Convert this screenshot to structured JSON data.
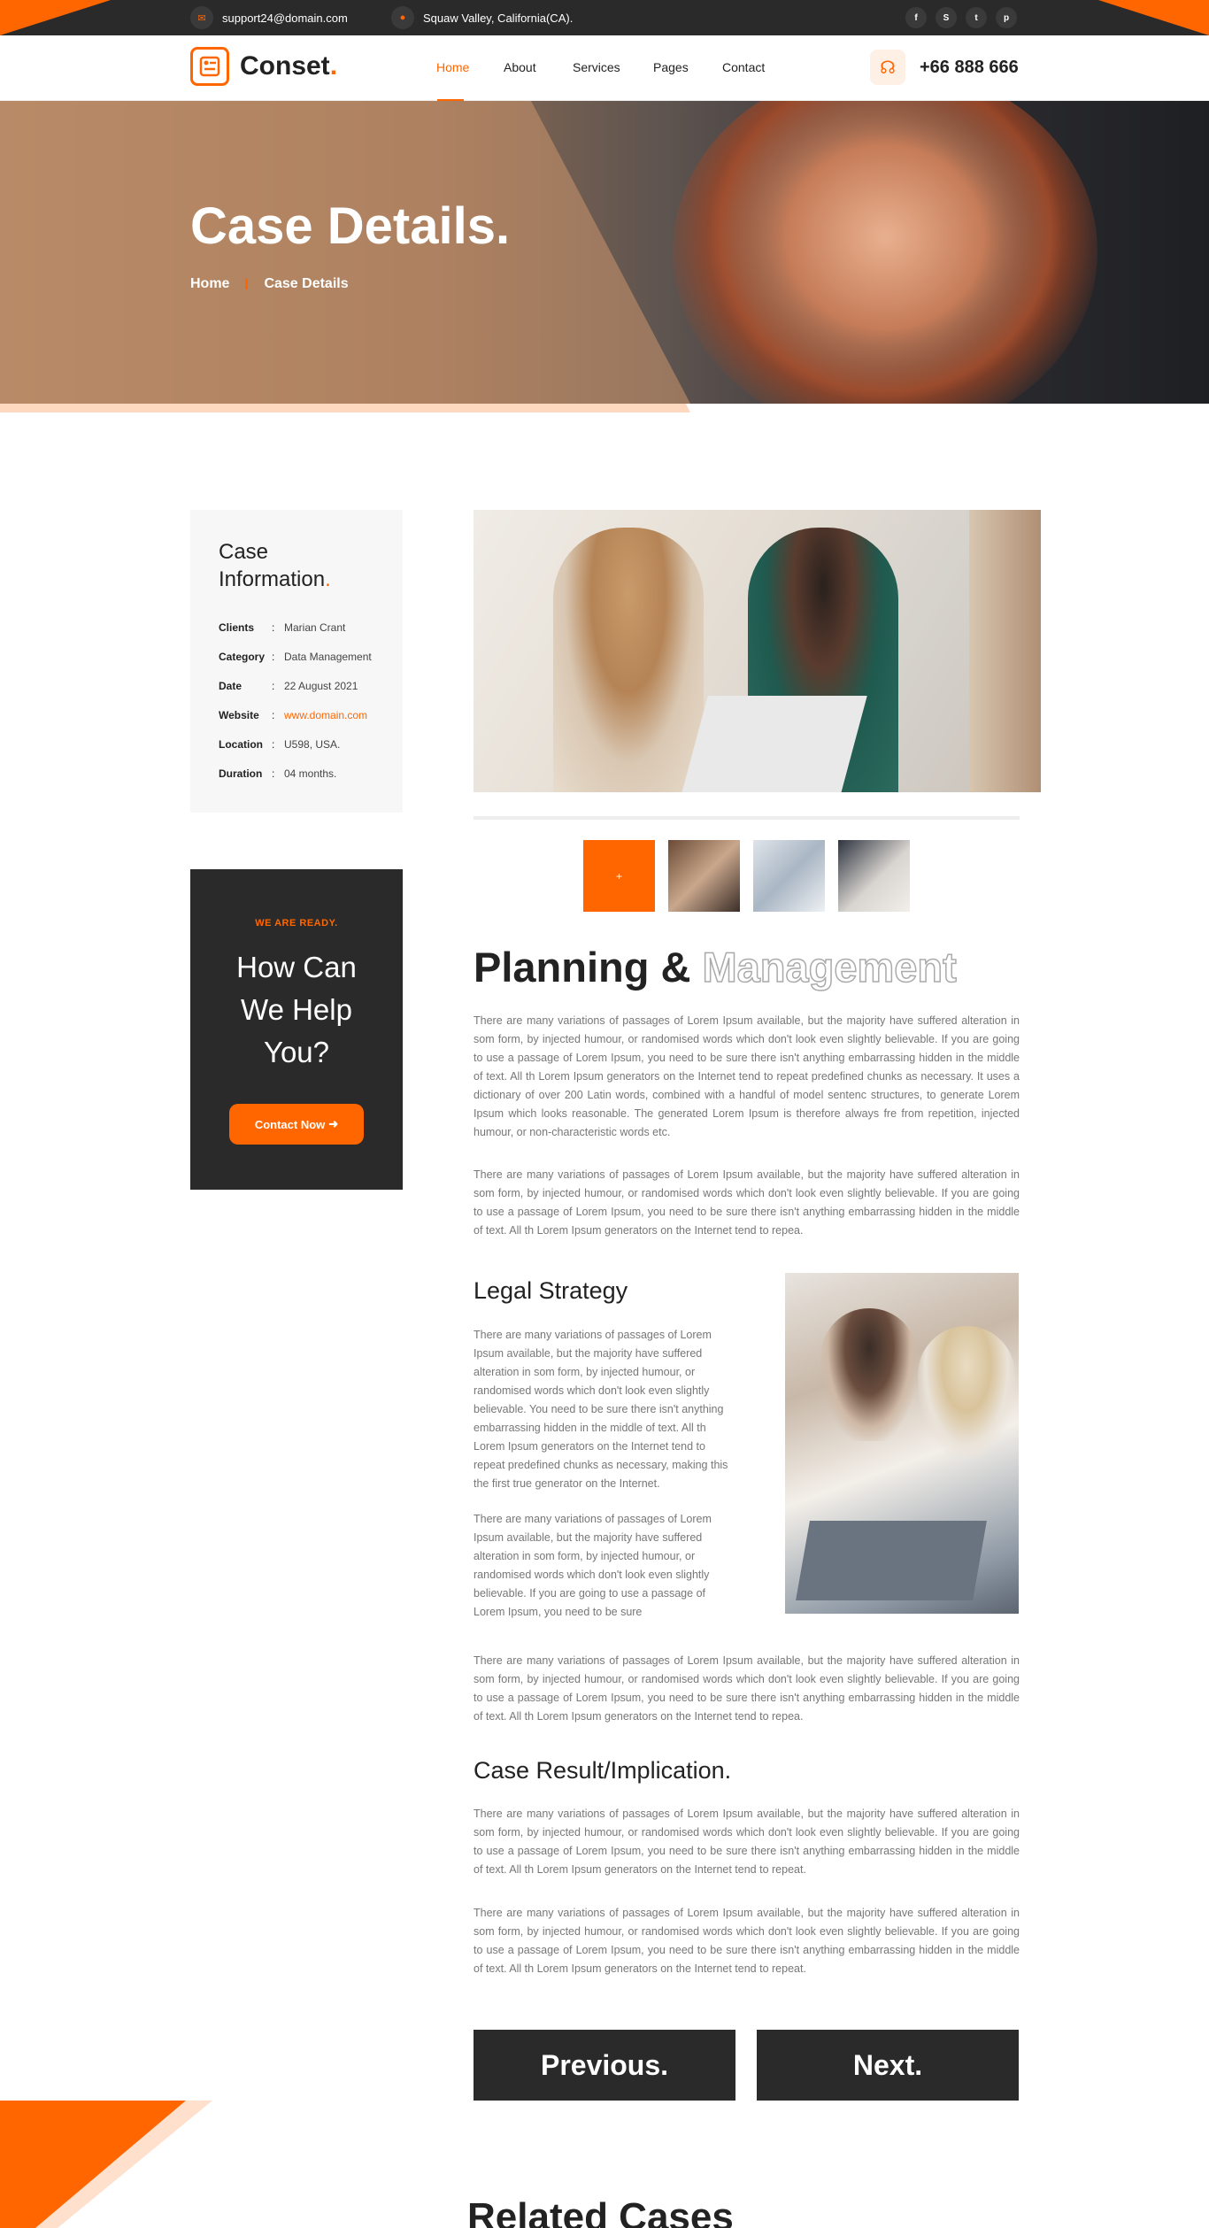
{
  "topbar": {
    "email": "support24@domain.com",
    "address": "Squaw Valley, California(CA).",
    "social_icons": [
      "facebook-icon",
      "skype-icon",
      "twitter-icon",
      "pinterest-icon"
    ],
    "social_glyphs": [
      "f",
      "S",
      "t",
      "p"
    ]
  },
  "header": {
    "logo": "Conset",
    "logo_dot": ".",
    "nav": [
      "Home",
      "About",
      "Services",
      "Pages",
      "Contact"
    ],
    "active_nav": "Home",
    "phone": "+66 888 666"
  },
  "hero": {
    "title": "Case Details.",
    "breadcrumb_home": "Home",
    "breadcrumb_current": "Case Details"
  },
  "case_info": {
    "title": "Case Information",
    "title_dot": ".",
    "rows": [
      {
        "key": "Clients",
        "value": "Marian Crant"
      },
      {
        "key": "Category",
        "value": "Data Management"
      },
      {
        "key": "Date",
        "value": "22 August 2021"
      },
      {
        "key": "Website",
        "value": "www.domain.com"
      },
      {
        "key": "Location",
        "value": "U598, USA."
      },
      {
        "key": "Duration",
        "value": "04 months."
      }
    ]
  },
  "help": {
    "eyebrow": "WE ARE READY.",
    "title_lines": [
      "How Can",
      "We Help",
      "You?"
    ],
    "button": "Contact Now"
  },
  "main": {
    "title_solid": "Planning &",
    "title_outline": "Management",
    "intro_paragraphs": [
      "There are many variations of passages of Lorem Ipsum available, but the majority have suffered alteration in som form, by injected humour, or randomised words which don't look even slightly believable. If you are going to use a passage of Lorem Ipsum, you need to be sure there isn't anything embarrassing hidden in the middle of text. All th Lorem Ipsum generators on the Internet tend to repeat predefined chunks as necessary. It uses a dictionary of over 200 Latin words, combined with a handful of model sentenc structures, to generate Lorem Ipsum which looks reasonable. The generated Lorem Ipsum is therefore always fre from repetition, injected humour, or non-characteristic words etc.",
      "There are many variations of passages of Lorem Ipsum available, but the majority have suffered alteration in som form, by injected humour, or randomised words which don't look even slightly believable. If you are going to use a passage of Lorem Ipsum, you need to be sure there isn't anything embarrassing hidden in the middle of text. All th Lorem Ipsum generators on the Internet tend to repea."
    ],
    "legal_title": "Legal Strategy",
    "legal_paragraphs": [
      "There are many variations of passages of Lorem Ipsum available, but the majority have suffered alteration in som form, by injected humour, or randomised words which don't look even slightly believable. You need to be sure there isn't anything embarrassing hidden in the middle of text. All th Lorem Ipsum generators on the Internet tend to repeat predefined chunks as necessary, making this the first true generator on the Internet.",
      "There are many variations of passages of Lorem Ipsum available, but the majority have suffered alteration in som form, by injected humour, or randomised words which don't look even slightly believable. If you are going to use a passage of Lorem Ipsum, you need to be sure"
    ],
    "after_legal": "There are many variations of passages of Lorem Ipsum available, but the majority have suffered alteration in som form, by injected humour, or randomised words which don't look even slightly believable. If you are going to use a passage of Lorem Ipsum, you need to be sure there isn't anything embarrassing hidden in the middle of text. All th Lorem Ipsum generators on the Internet tend to repea.",
    "result_title": "Case Result/Implication.",
    "result_paragraphs": [
      "There are many variations of passages of Lorem Ipsum available, but the majority have suffered alteration in som form, by injected humour, or randomised words which don't look even slightly believable. If you are going to use a passage of Lorem Ipsum, you need to be sure there isn't anything embarrassing hidden in the middle of text. All th Lorem Ipsum generators on the Internet tend to repeat.",
      "There are many variations of passages of Lorem Ipsum available, but the majority have suffered alteration in som form, by injected humour, or randomised words which don't look even slightly believable. If you are going to use a passage of Lorem Ipsum, you need to be sure there isn't anything embarrassing hidden in the middle of text. All th Lorem Ipsum generators on the Internet tend to repeat."
    ],
    "prev_button": "Previous.",
    "next_button": "Next.",
    "thumb_plus": "+"
  },
  "related_title": "Related Cases",
  "colors": {
    "accent": "#ff6600",
    "dark": "#2a2a2a",
    "text_muted": "#777777"
  }
}
